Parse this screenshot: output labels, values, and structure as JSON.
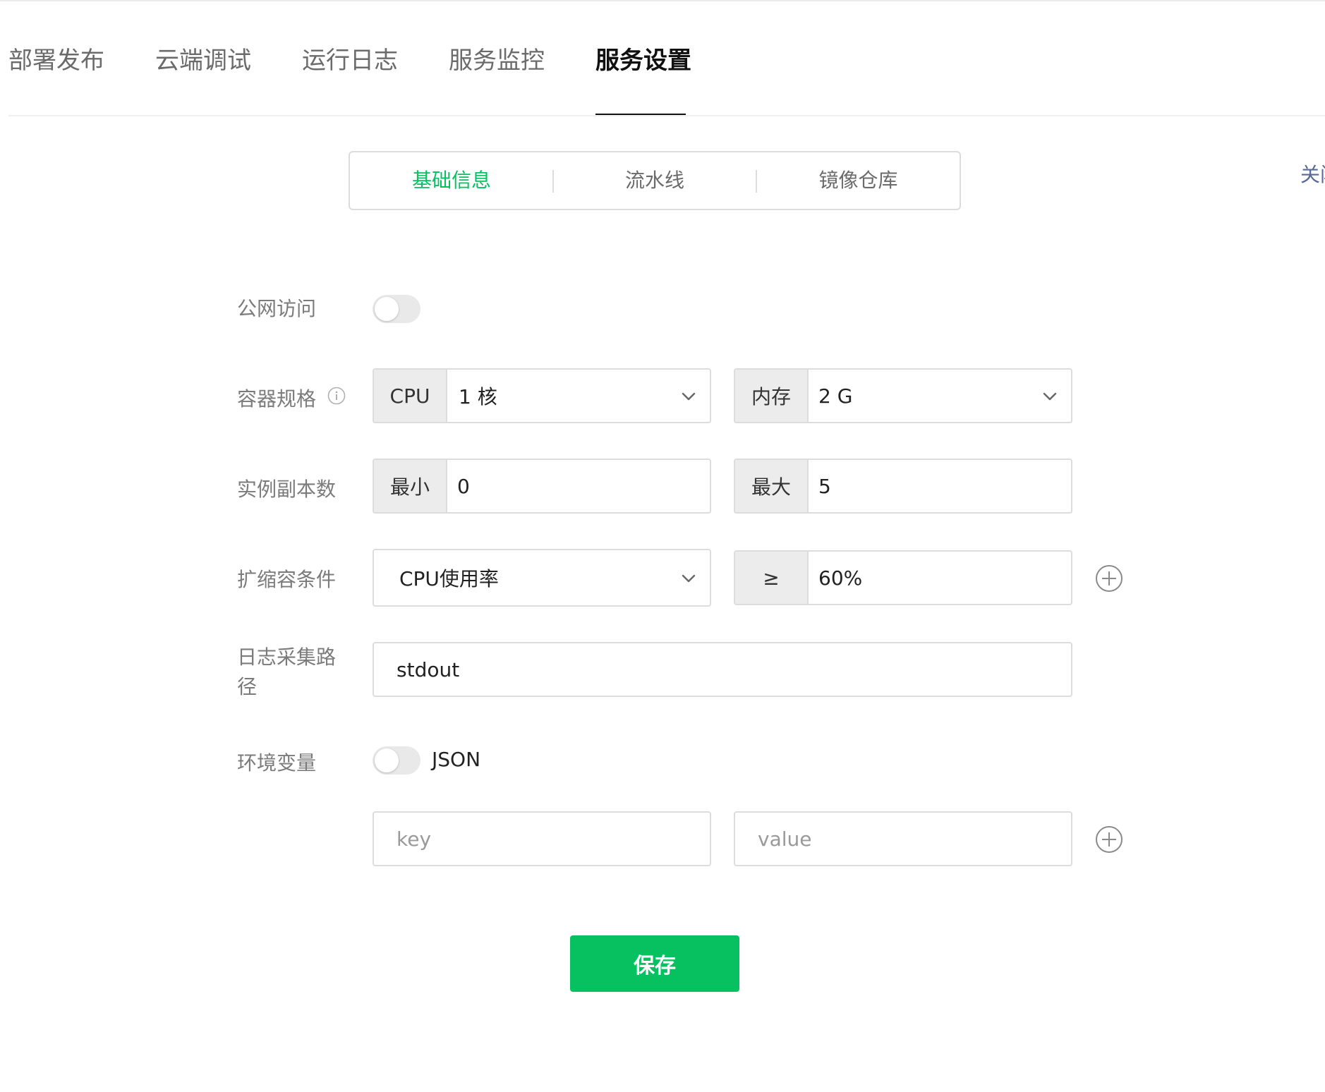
{
  "tabs": [
    {
      "label": "部署发布"
    },
    {
      "label": "云端调试"
    },
    {
      "label": "运行日志"
    },
    {
      "label": "服务监控"
    },
    {
      "label": "服务设置",
      "active": true
    }
  ],
  "segment": {
    "items": [
      {
        "label": "基础信息",
        "active": true
      },
      {
        "label": "流水线"
      },
      {
        "label": "镜像仓库"
      }
    ]
  },
  "side_link": "关闭",
  "form": {
    "public_access": {
      "label": "公网访问",
      "enabled": false
    },
    "container_spec": {
      "label": "容器规格",
      "cpu": {
        "addon": "CPU",
        "value": "1 核"
      },
      "memory": {
        "addon": "内存",
        "value": "2 G"
      }
    },
    "replicas": {
      "label": "实例副本数",
      "min": {
        "addon": "最小",
        "value": "0"
      },
      "max": {
        "addon": "最大",
        "value": "5"
      }
    },
    "scaling": {
      "label": "扩缩容条件",
      "metric": "CPU使用率",
      "operator": "≥",
      "threshold": "60%"
    },
    "log_path": {
      "label_line1": "日志采集路",
      "label_line2": "径",
      "value": "stdout"
    },
    "env": {
      "label": "环境变量",
      "json_label": "JSON",
      "json_enabled": false,
      "key_placeholder": "key",
      "value_placeholder": "value"
    }
  },
  "save_label": "保存",
  "colors": {
    "accent": "#07c160",
    "link": "#576b95"
  }
}
